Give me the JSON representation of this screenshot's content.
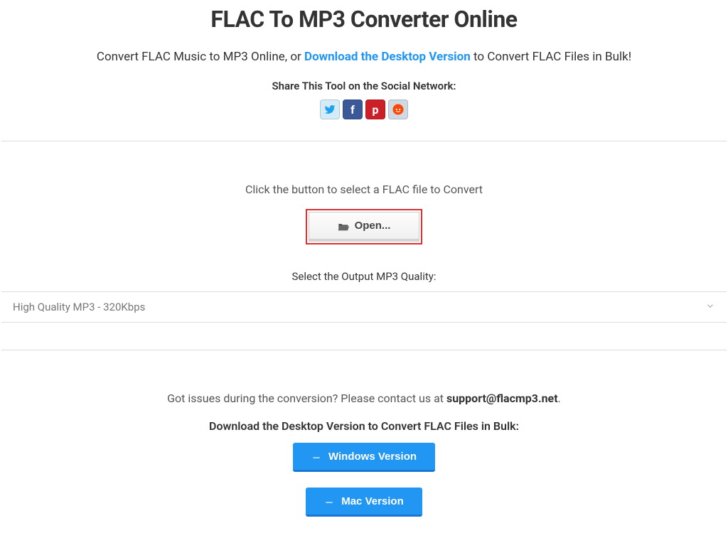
{
  "header": {
    "title": "FLAC To MP3 Converter Online",
    "subtitle_prefix": "Convert FLAC Music to MP3 Online, or ",
    "subtitle_link": "Download the Desktop Version",
    "subtitle_suffix": " to Convert FLAC Files in Bulk!",
    "share_label": "Share This Tool on the Social Network:",
    "social": {
      "twitter": "t",
      "facebook": "f",
      "pinterest": "p",
      "reddit": "👽"
    }
  },
  "main": {
    "instruction": "Click the button to select a FLAC file to Convert",
    "open_button": "Open...",
    "quality_label": "Select the Output MP3 Quality:",
    "quality_value": "High Quality MP3 - 320Kbps"
  },
  "footer": {
    "support_prefix": "Got issues during the conversion? Please contact us at ",
    "support_email": "support@flacmp3.net",
    "support_suffix": ".",
    "download_label": "Download the Desktop Version to Convert FLAC Files in Bulk:",
    "windows_button": "Windows Version",
    "mac_button": "Mac Version"
  }
}
